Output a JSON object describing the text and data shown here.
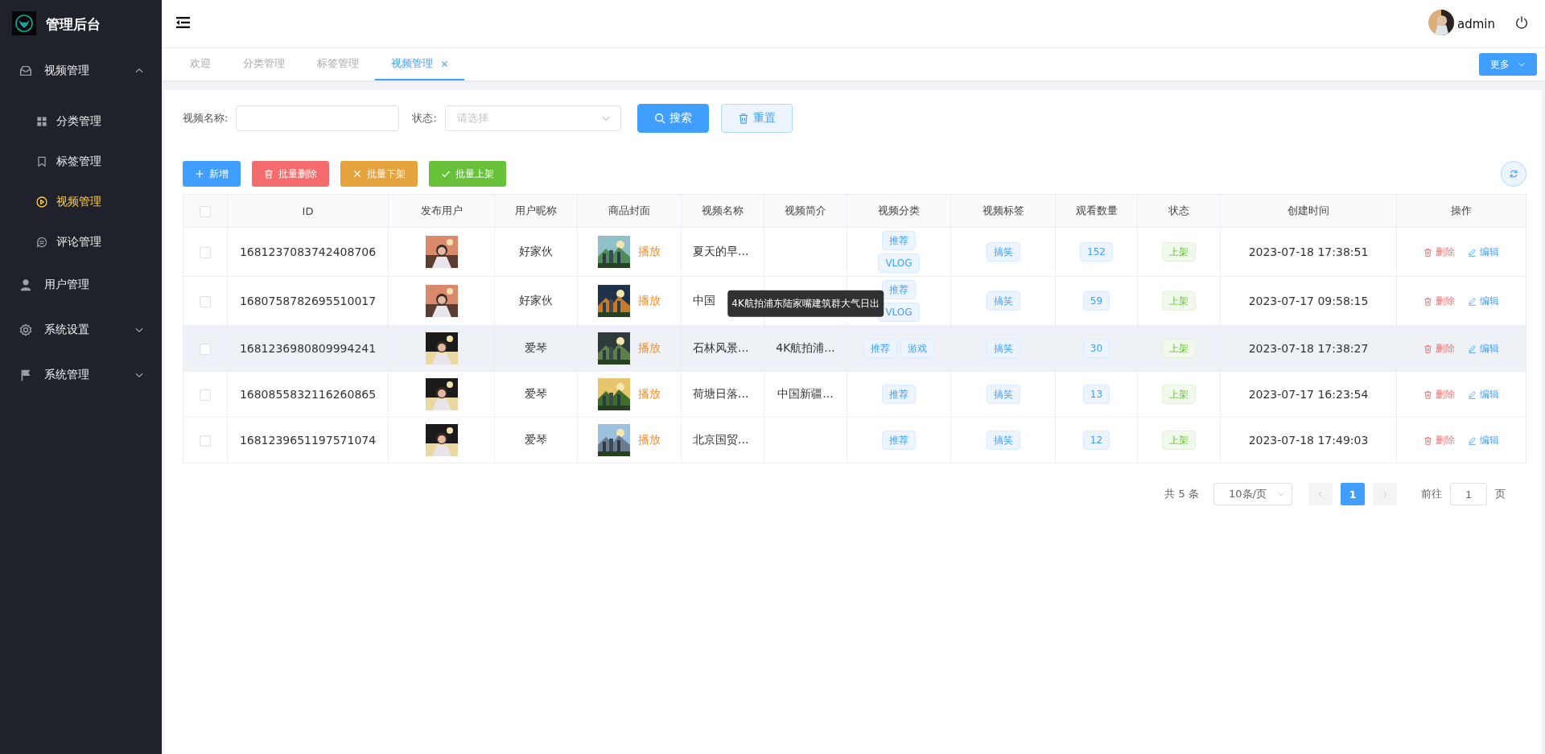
{
  "app": {
    "title": "管理后台"
  },
  "sidebar": {
    "items": [
      {
        "label": "视频管理",
        "kind": "group",
        "expanded": true,
        "children": [
          {
            "label": "分类管理",
            "selected": false
          },
          {
            "label": "标签管理",
            "selected": false
          },
          {
            "label": "视频管理",
            "selected": true
          },
          {
            "label": "评论管理",
            "selected": false
          }
        ]
      },
      {
        "label": "用户管理",
        "kind": "link"
      },
      {
        "label": "系统设置",
        "kind": "group",
        "expanded": false
      },
      {
        "label": "系统管理",
        "kind": "group",
        "expanded": false
      }
    ]
  },
  "header": {
    "user": "admin"
  },
  "tabs": [
    {
      "label": "欢迎",
      "selected": false,
      "closable": false
    },
    {
      "label": "分类管理",
      "selected": false,
      "closable": false
    },
    {
      "label": "标签管理",
      "selected": false,
      "closable": false
    },
    {
      "label": "视频管理",
      "selected": true,
      "closable": true
    }
  ],
  "more_button": "更多",
  "filters": [
    {
      "label": "视频名称:",
      "kind": "text"
    },
    {
      "label": "状态:",
      "kind": "select",
      "placeholder": "请选择"
    }
  ],
  "filter_buttons": [
    {
      "label": "搜索",
      "kind": "search"
    },
    {
      "label": "重置",
      "kind": "reset"
    }
  ],
  "actions": [
    {
      "label": "新增",
      "kind": "add"
    },
    {
      "label": "批量删除",
      "kind": "delete"
    },
    {
      "label": "批量下架",
      "kind": "unlist"
    },
    {
      "label": "批量上架",
      "kind": "list"
    }
  ],
  "table": {
    "select_all": {
      "checked": false
    },
    "columns": [
      "ID",
      "发布用户",
      "用户昵称",
      "商品封面",
      "视频名称",
      "视频简介",
      "视频分类",
      "视频标签",
      "观看数量",
      "状态",
      "创建时间",
      "操作"
    ],
    "rows": [
      {
        "checked": false,
        "highlighted": false,
        "id": "1681237083742408706",
        "nickname": "好家伙",
        "play": "播放",
        "name": "夏天的早...",
        "categories": [
          "推荐",
          "VLOG"
        ],
        "tags": [
          "搞笑"
        ],
        "views": "152",
        "status": "上架",
        "created": "2023-07-18 17:38:51",
        "actions": [
          "删除",
          "编辑"
        ]
      },
      {
        "checked": false,
        "highlighted": false,
        "id": "1680758782695510017",
        "nickname": "好家伙",
        "play": "播放",
        "name": "中国",
        "tooltip": "4K航拍浦东陆家嘴建筑群大气日出",
        "categories": [
          "推荐",
          "VLOG"
        ],
        "tags": [
          "搞笑"
        ],
        "views": "59",
        "status": "上架",
        "created": "2023-07-17 09:58:15",
        "actions": [
          "删除",
          "编辑"
        ]
      },
      {
        "checked": false,
        "highlighted": true,
        "id": "1681236980809994241",
        "nickname": "爱琴",
        "play": "播放",
        "name": "石林风景...",
        "intro": "4K航拍浦...",
        "categories": [
          "推荐",
          "游戏"
        ],
        "tags": [
          "搞笑"
        ],
        "views": "30",
        "status": "上架",
        "created": "2023-07-18 17:38:27",
        "actions": [
          "删除",
          "编辑"
        ]
      },
      {
        "checked": false,
        "highlighted": false,
        "id": "1680855832116260865",
        "nickname": "爱琴",
        "play": "播放",
        "name": "荷塘日落...",
        "intro": "中国新疆...",
        "categories": [
          "推荐"
        ],
        "tags": [
          "搞笑"
        ],
        "views": "13",
        "status": "上架",
        "created": "2023-07-17 16:23:54",
        "actions": [
          "删除",
          "编辑"
        ]
      },
      {
        "checked": false,
        "highlighted": false,
        "id": "1681239651197571074",
        "nickname": "爱琴",
        "play": "播放",
        "name": "北京国贸...",
        "categories": [
          "推荐"
        ],
        "tags": [
          "搞笑"
        ],
        "views": "12",
        "status": "上架",
        "created": "2023-07-18 17:49:03",
        "actions": [
          "删除",
          "编辑"
        ]
      }
    ]
  },
  "pagination": {
    "total": "共 5 条",
    "page_size": "10条/页",
    "pages": [
      {
        "label": "1",
        "selected": true
      }
    ],
    "goto_label": "前往",
    "goto_value": "1",
    "goto_suffix": "页"
  }
}
